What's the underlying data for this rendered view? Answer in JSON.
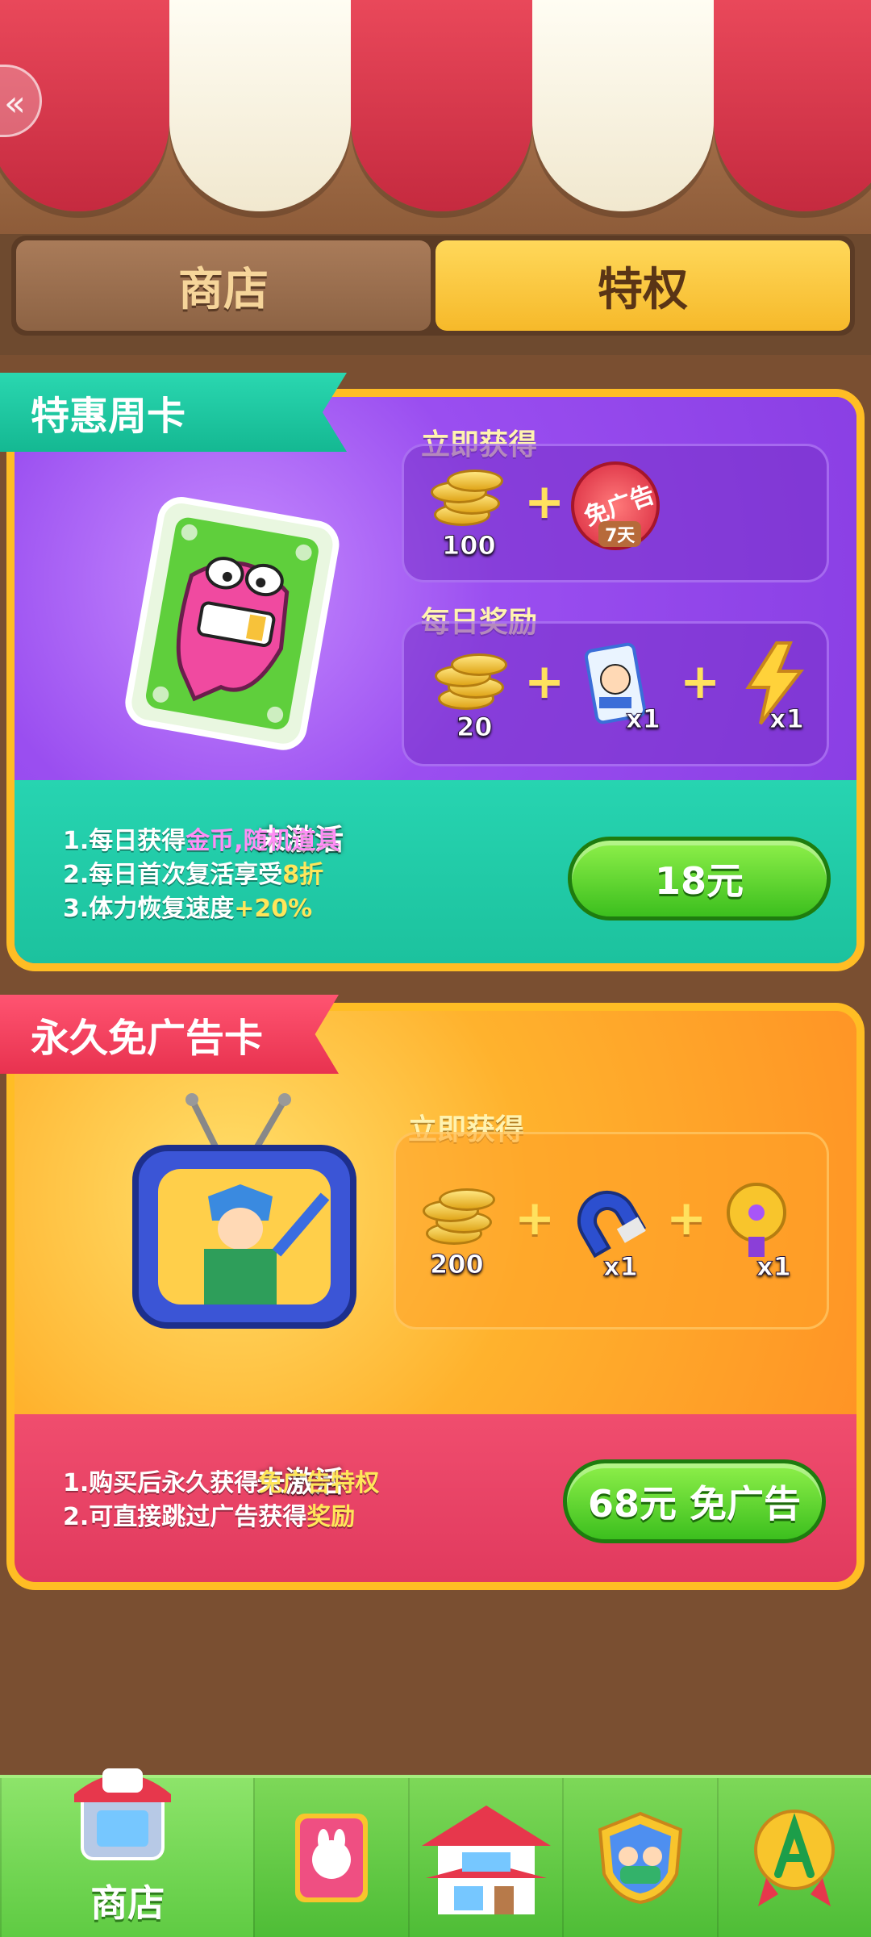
{
  "tabs": {
    "shop": "商店",
    "privilege": "特权",
    "active": "privilege"
  },
  "weekly_card": {
    "title": "特惠周卡",
    "status": "未激活",
    "instant_label": "立即获得",
    "instant_rewards": {
      "coins": "100",
      "noad_line1": "免广告",
      "noad_days": "7天"
    },
    "daily_label": "每日奖励",
    "daily_rewards": {
      "coins": "20",
      "item_qty": "x1",
      "energy_qty": "x1"
    },
    "desc": {
      "line1_a": "1.每日获得",
      "line1_b": "金币,随机道具",
      "line2_a": "2.每日首次复活享受",
      "line2_b": "8折",
      "line3_a": "3.体力恢复速度",
      "line3_b": "+20%"
    },
    "price_button": "18元"
  },
  "noad_card": {
    "title": "永久免广告卡",
    "status": "未激活",
    "instant_label": "立即获得",
    "instant_rewards": {
      "coins": "200",
      "magnet_qty": "x1",
      "fan_qty": "x1"
    },
    "desc": {
      "line1_a": "1.购买后永久获得",
      "line1_b": "免广告特权",
      "line2_a": "2.可直接跳过广告获得",
      "line2_b": "奖励"
    },
    "price_button": "68元 免广告"
  },
  "bottom_nav": {
    "items": [
      {
        "icon": "shop-icon",
        "label": "商店",
        "active": true
      },
      {
        "icon": "book-icon",
        "label": ""
      },
      {
        "icon": "house-icon",
        "label": ""
      },
      {
        "icon": "team-badge-icon",
        "label": ""
      },
      {
        "icon": "achievement-icon",
        "label": ""
      }
    ]
  },
  "colors": {
    "accent_gold": "#ffbd24",
    "weekly_purple": "#8a3fe4",
    "weekly_teal": "#1cc29e",
    "noad_orange": "#ff9425",
    "noad_red": "#e13a5e",
    "button_green": "#3cbf1e"
  }
}
